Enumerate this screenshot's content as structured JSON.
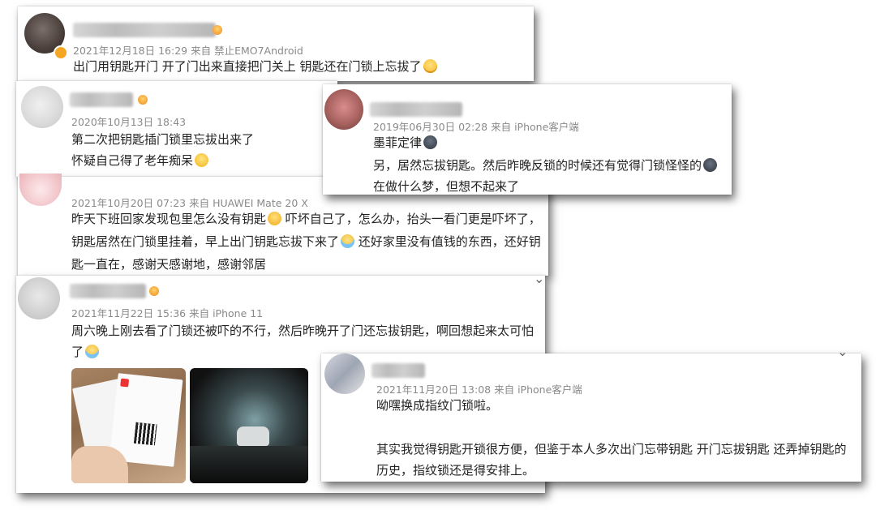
{
  "comments": [
    {
      "id": "c1",
      "meta": "2021年12月18日 16:29  来自 禁止EMO7Android",
      "lines": [
        "出门用钥匙开门 开了门出来直接把门关上 钥匙还在门锁上忘拔了"
      ],
      "emoji": "grin-face-icon"
    },
    {
      "id": "c2",
      "meta": "2020年10月13日 18:43",
      "lines": [
        "第二次把钥匙插门锁里忘拔出来了",
        "怀疑自己得了老年痴呆"
      ],
      "emoji": "smile-face-icon"
    },
    {
      "id": "c3",
      "meta": "2019年06月30日 02:28  来自 iPhone客户端",
      "lines": [
        "墨菲定律",
        "另，居然忘拔钥匙。然后昨晚反锁的时候还有觉得门锁怪怪的",
        "在做什么梦，但想不起来了"
      ],
      "emoji": "dark-face-icon"
    },
    {
      "id": "c4",
      "meta": "2021年10月20日 07:23  来自 HUAWEI Mate 20 X",
      "lines": [
        "昨天下班回家发现包里怎么没有钥匙",
        " 吓坏自己了，怎么办，抬头一看门更是吓坏了，",
        "钥匙居然在门锁里挂着，早上出门钥匙忘拔下来了",
        " 还好家里没有值钱的东西，还好钥",
        "匙一直在，感谢天感谢地，感谢邻居"
      ],
      "emoji": "sad-face-icon"
    },
    {
      "id": "c5",
      "meta": "2021年11月22日 15:36  来自 iPhone 11",
      "lines": [
        "周六晚上刚去看了门锁还被吓的不行，然后昨晚开了门还忘拔钥匙，啊回想起来太可怕",
        "了"
      ],
      "emoji": "cry-face-icon"
    },
    {
      "id": "c6",
      "meta": "2021年11月20日 13:08  来自 iPhone客户端",
      "lines": [
        "呦嘿换成指纹门锁啦。",
        "",
        "其实我觉得钥匙开锁很方便，但鉴于本人多次出门忘带钥匙 开门忘拔钥匙 还弄掉钥匙的",
        "历史，指纹锁还是得安排上。"
      ]
    }
  ],
  "chevron": "chevron-down-icon"
}
